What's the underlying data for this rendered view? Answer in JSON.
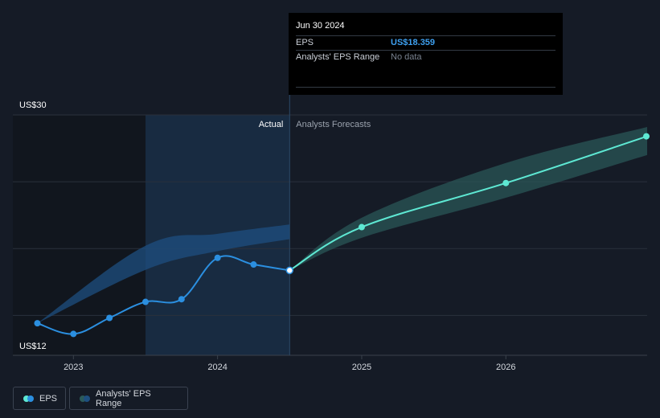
{
  "tooltip": {
    "date": "Jun 30 2024",
    "eps_label": "EPS",
    "eps_value": "US$18.359",
    "range_label": "Analysts' EPS Range",
    "range_value": "No data"
  },
  "legend": {
    "eps_label": "EPS",
    "range_label": "Analysts' EPS Range"
  },
  "colors": {
    "actual_line": "#2b8fe0",
    "forecast_line": "#5ee8d3",
    "actual_band": "#1e4f80",
    "forecast_band": "#2b5a5a",
    "highlight_region": "#182b41",
    "past_region": "#11161e"
  },
  "chart_data": {
    "type": "line",
    "y_axis_labels": [
      "US$30",
      "US$12"
    ],
    "ylim": [
      12,
      30
    ],
    "x_tick_labels": [
      "2023",
      "2024",
      "2025",
      "2026"
    ],
    "x_ticks": [
      2023.0,
      2024.0,
      2025.0,
      2026.0
    ],
    "xlim": [
      2022.58,
      2026.98
    ],
    "region_labels": {
      "actual": "Actual",
      "forecast": "Analysts Forecasts"
    },
    "divider_x": 2024.5,
    "highlight_start_x": 2023.5,
    "series": [
      {
        "name": "EPS",
        "kind": "actual",
        "points": [
          [
            2022.75,
            14.4
          ],
          [
            2023.0,
            13.6
          ],
          [
            2023.25,
            14.8
          ],
          [
            2023.5,
            16.0
          ],
          [
            2023.75,
            16.2
          ],
          [
            2024.0,
            19.3
          ],
          [
            2024.25,
            18.8
          ],
          [
            2024.5,
            18.359
          ]
        ]
      },
      {
        "name": "EPS",
        "kind": "forecast",
        "points": [
          [
            2024.5,
            18.359
          ],
          [
            2025.0,
            21.6
          ],
          [
            2026.0,
            24.9
          ],
          [
            2026.98,
            28.4
          ]
        ]
      }
    ],
    "ranges": [
      {
        "name": "Analysts' EPS Range",
        "kind": "actual",
        "points": [
          [
            2022.75,
            14.4,
            14.4
          ],
          [
            2023.5,
            18.4,
            20.2
          ],
          [
            2024.0,
            19.8,
            21.1
          ],
          [
            2024.5,
            20.7,
            21.8
          ]
        ]
      },
      {
        "name": "Analysts' EPS Range",
        "kind": "forecast",
        "points": [
          [
            2024.5,
            18.359,
            18.359
          ],
          [
            2025.0,
            20.8,
            22.3
          ],
          [
            2026.0,
            23.8,
            26.4
          ],
          [
            2026.98,
            27.0,
            29.1
          ]
        ]
      }
    ]
  }
}
